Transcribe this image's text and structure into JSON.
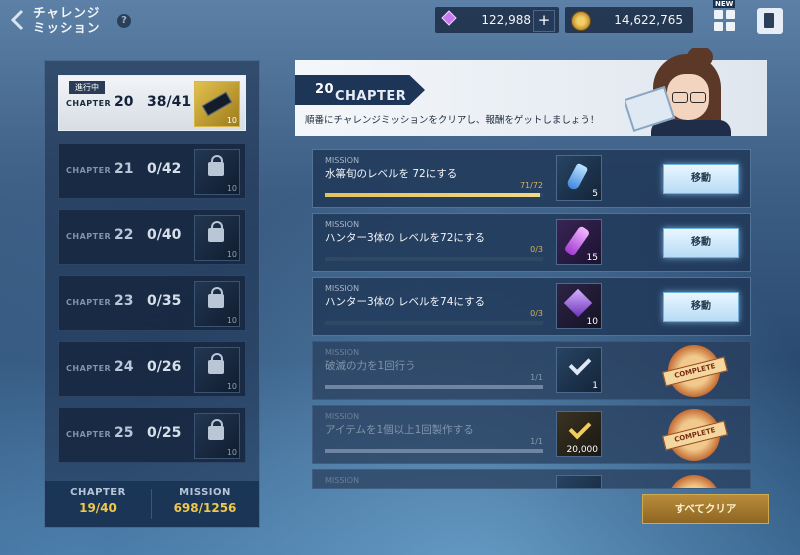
{
  "header": {
    "title_line1": "チャレンジ",
    "title_line2": "ミッション",
    "help": "?",
    "gems": "122,988",
    "gold": "14,622,765",
    "plus": "+",
    "new_badge": "NEW"
  },
  "chapters": [
    {
      "label": "CHAPTER",
      "num": "20",
      "progress": "38/41",
      "badge": "進行中",
      "count": "10",
      "active": true
    },
    {
      "label": "CHAPTER",
      "num": "21",
      "progress": "0/42",
      "count": "10"
    },
    {
      "label": "CHAPTER",
      "num": "22",
      "progress": "0/40",
      "count": "10"
    },
    {
      "label": "CHAPTER",
      "num": "23",
      "progress": "0/35",
      "count": "10"
    },
    {
      "label": "CHAPTER",
      "num": "24",
      "progress": "0/26",
      "count": "10"
    },
    {
      "label": "CHAPTER",
      "num": "25",
      "progress": "0/25",
      "count": "10"
    }
  ],
  "summary": {
    "chapter_label": "CHAPTER",
    "chapter_value": "19/40",
    "mission_label": "MISSION",
    "mission_value": "698/1256"
  },
  "chapter_header": {
    "label": "CHAPTER",
    "num": "20",
    "description": "順番にチャレンジミッションをクリアし、報酬をゲットしましょう！"
  },
  "missions": [
    {
      "label": "MISSION",
      "text": "水箒旬のレベルを 72にする",
      "progress": "71/72",
      "fraction": 0.986,
      "reward_count": "5",
      "button": "移動",
      "status": "active"
    },
    {
      "label": "MISSION",
      "text": "ハンター3体の レベルを72にする",
      "progress": "0/3",
      "fraction": 0.0,
      "reward_count": "15",
      "button": "移動",
      "status": "active"
    },
    {
      "label": "MISSION",
      "text": "ハンター3体の レベルを74にする",
      "progress": "0/3",
      "fraction": 0.0,
      "reward_count": "10",
      "button": "移動",
      "status": "active"
    },
    {
      "label": "MISSION",
      "text": "破滅の力を1回行う",
      "progress": "1/1",
      "fraction": 1.0,
      "reward_count": "1",
      "stamp": "COMPLETE",
      "status": "done"
    },
    {
      "label": "MISSION",
      "text": "アイテムを1個以上1回製作する",
      "progress": "1/1",
      "fraction": 1.0,
      "reward_count": "20,000",
      "stamp": "COMPLETE",
      "status": "done"
    },
    {
      "label": "MISSION",
      "text": "",
      "progress": "",
      "fraction": 1.0,
      "reward_count": "",
      "stamp": "",
      "status": "done"
    }
  ],
  "clear_all_button": "すべてクリア"
}
